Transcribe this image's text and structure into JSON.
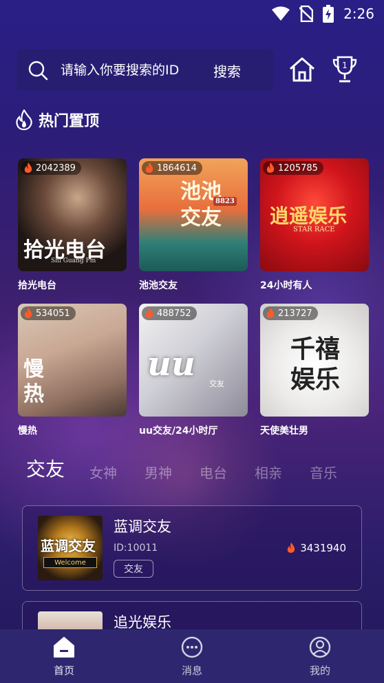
{
  "status_bar": {
    "time": "2:26",
    "icons": [
      "wifi-icon",
      "no-sim-icon",
      "battery-charging-icon"
    ]
  },
  "search": {
    "placeholder": "请输入你要搜索的ID",
    "button_label": "搜索",
    "icon": "search-icon"
  },
  "header_icons": [
    "home-icon",
    "trophy-icon"
  ],
  "hot_section": {
    "title": "热门置顶",
    "icon": "fire-icon",
    "items": [
      {
        "count": "2042389",
        "name": "拾光电台",
        "art_text": "拾光电台",
        "art_sub": "Shi Guang Fm"
      },
      {
        "count": "1864614",
        "name": "池池交友",
        "art_text": "池池交友",
        "art_sub": "8823"
      },
      {
        "count": "1205785",
        "name": "24小时有人",
        "art_text": "逍遥娱乐",
        "art_sub": "STAR RACE"
      },
      {
        "count": "534051",
        "name": "慢热",
        "art_text": "慢热",
        "art_sub": ""
      },
      {
        "count": "488752",
        "name": "uu交友/24小时厅",
        "art_text": "uu",
        "art_sub": "交友"
      },
      {
        "count": "213727",
        "name": "天使美壮男",
        "art_text": "千禧娱乐",
        "art_sub": ""
      }
    ]
  },
  "tabs": [
    "交友",
    "女神",
    "男神",
    "电台",
    "相亲",
    "音乐"
  ],
  "active_tab": "交友",
  "rooms": [
    {
      "name": "蓝调交友",
      "id": "ID:10011",
      "tag": "交友",
      "count": "3431940",
      "art_text": "蓝调交友",
      "art_sub": "Welcome"
    },
    {
      "name": "追光娱乐",
      "id": "",
      "tag": "",
      "count": "",
      "art_text": "",
      "art_sub": ""
    }
  ],
  "bottom_nav": [
    {
      "label": "首页",
      "icon": "home-icon"
    },
    {
      "label": "消息",
      "icon": "message-icon"
    },
    {
      "label": "我的",
      "icon": "profile-icon"
    }
  ],
  "colors": {
    "background": "#2b1d7a",
    "nav_bar": "#2e2770",
    "accent_fire": "#ff5a2a"
  }
}
